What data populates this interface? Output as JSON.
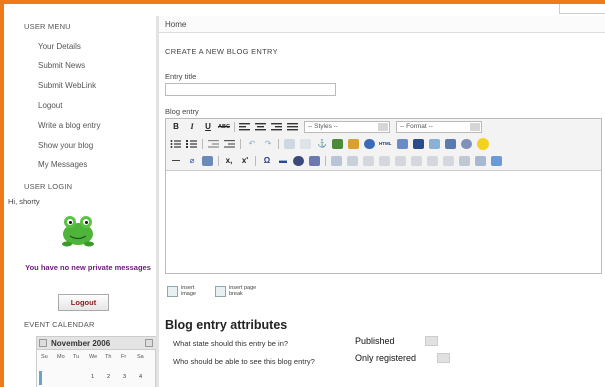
{
  "sidebar": {
    "user_menu_heading": "USER MENU",
    "menu_items": [
      {
        "label": "Your Details"
      },
      {
        "label": "Submit News"
      },
      {
        "label": "Submit WebLink"
      },
      {
        "label": "Logout"
      },
      {
        "label": "Write a blog entry"
      },
      {
        "label": "Show your blog"
      },
      {
        "label": "My Messages"
      }
    ],
    "user_login_heading": "USER LOGIN",
    "greeting": "Hi, shorty",
    "no_messages": "You have no new private messages",
    "logout_button": "Logout",
    "event_calendar_heading": "EVENT CALENDAR",
    "calendar": {
      "month": "November 2006",
      "weekdays": [
        "Su",
        "Mo",
        "Tu",
        "We",
        "Th",
        "Fr",
        "Sa"
      ],
      "first_row_days": [
        "1",
        "2",
        "3",
        "4"
      ]
    }
  },
  "content": {
    "breadcrumb": "Home",
    "form_title": "CREATE A NEW BLOG ENTRY",
    "entry_title_label": "Entry title",
    "entry_title_value": "",
    "blog_entry_label": "Blog entry",
    "toolbar": {
      "styles_select": "-- Styles --",
      "format_select": "-- Format --"
    },
    "insert_image": "insert image",
    "insert_page_break": "insert page break",
    "attributes_heading": "Blog entry attributes",
    "state_question": "What state should this entry be in?",
    "state_value": "Published",
    "visibility_question": "Who should be able to see this blog entry?",
    "visibility_value": "Only registered"
  },
  "colors": {
    "frame_accent": "#f07a1a",
    "message_text": "#6a1a78",
    "logout_text": "#8a1a1a"
  },
  "icons": [
    "bold-icon",
    "italic-icon",
    "underline-icon",
    "strikethrough-icon",
    "align-left-icon",
    "align-center-icon",
    "align-right-icon",
    "justify-icon",
    "bullet-list-icon",
    "numbered-list-icon",
    "outdent-icon",
    "indent-icon",
    "undo-icon",
    "redo-icon",
    "link-icon",
    "unlink-icon",
    "anchor-icon",
    "image-icon",
    "cleanup-icon",
    "help-icon",
    "html-icon",
    "find-icon",
    "replace-icon",
    "emoticon-icon",
    "horizontal-rule-icon",
    "subscript-icon",
    "superscript-icon",
    "special-char-icon",
    "table-icon",
    "frog-avatar",
    "calendar-prev-icon",
    "calendar-next-icon"
  ]
}
